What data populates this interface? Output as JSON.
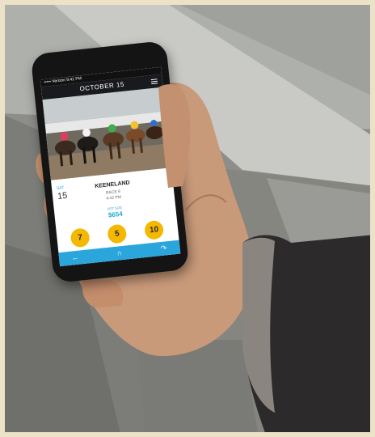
{
  "phone": {
    "status": "••••• Verizon  9:41 PM",
    "header_title": "OCTOBER 15",
    "race": {
      "day_label": "SAT",
      "day_number": "15",
      "track": "KEENELAND",
      "race_number": "RACE 8",
      "post_time": "4:42 PM",
      "pot_label": "POT SIZE",
      "pot_value": "$654"
    },
    "picks": [
      "7",
      "5",
      "10"
    ],
    "nav": {
      "back_icon": "back-arrow-icon",
      "center_icon": "horseshoe-icon",
      "share_icon": "share-arrow-icon"
    }
  },
  "colors": {
    "accent_blue": "#2aa6dc",
    "pick_yellow": "#f5b800",
    "header_dark": "#191a1d",
    "border_cream": "#ece2c8"
  }
}
